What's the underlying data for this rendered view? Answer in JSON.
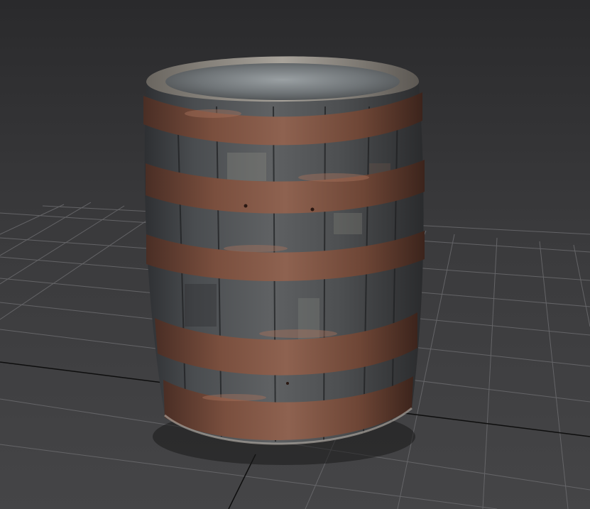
{
  "viewport": {
    "label": "",
    "colors": {
      "background_top": "#2a2a2c",
      "background_bottom": "#454547",
      "grid_line": "#6b6b6e",
      "grid_axis": "#0c0c0c",
      "wood_dark": "#3e4043",
      "wood_light": "#6e6e68",
      "rust_band": "#7a4f3e",
      "rust_highlight": "#9a6a55",
      "lid": "#8c9397"
    }
  },
  "scene": {
    "object_icon": "barrel-icon",
    "grid_icon": "ground-grid-icon"
  }
}
